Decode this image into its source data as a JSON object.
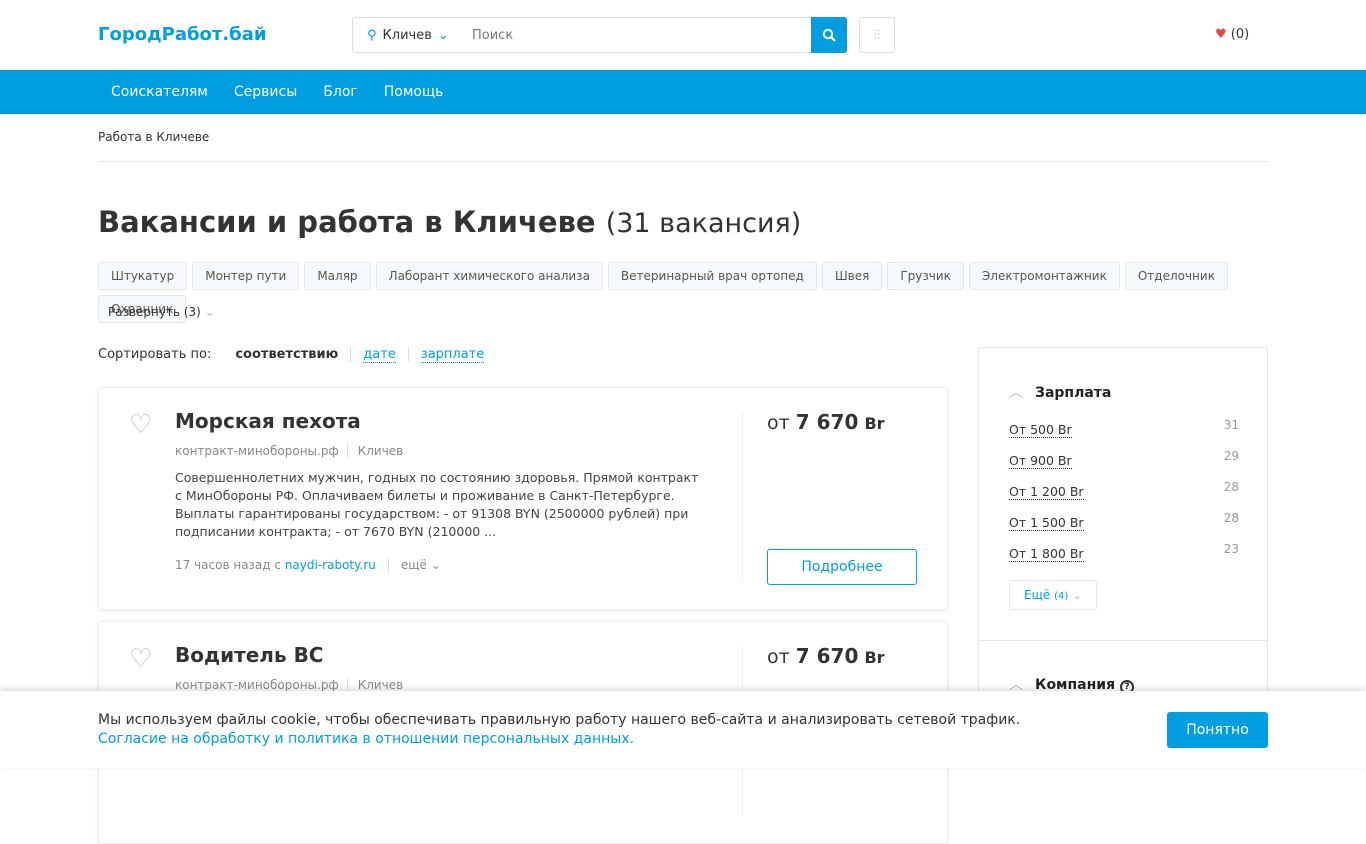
{
  "header": {
    "logo": "ГородРабот.бай",
    "location": "Кличев",
    "search_placeholder": "Поиск",
    "favorites": "(0)"
  },
  "nav": [
    "Соискателям",
    "Сервисы",
    "Блог",
    "Помощь"
  ],
  "breadcrumb": "Работа в Кличеве",
  "page_title": "Вакансии и работа в Кличеве",
  "page_count": "(31 вакансия)",
  "tags": [
    "Штукатур",
    "Монтер пути",
    "Маляр",
    "Лаборант химического анализа",
    "Ветеринарный врач ортопед",
    "Швея",
    "Грузчик",
    "Электромонтажник",
    "Отделочник",
    "Охранник"
  ],
  "expand": "Развернуть (3)",
  "sort": {
    "label": "Сортировать по:",
    "active": "соответствию",
    "options": [
      "дате",
      "зарплате"
    ]
  },
  "vacancies": [
    {
      "title": "Морская пехота",
      "company": "контракт-минобороны.рф",
      "city": "Кличев",
      "description": "Совершеннолетних мужчин, годных по состоянию здоровья. Прямой контракт с МинОбороны РФ. Оплачиваем билеты и проживание в Санкт-Петербурге. Выплаты гарантированы государством: - от 91308 BYN (2500000 рублей) при подписании контракта; - от 7670 BYN (210000 ...",
      "time": "17 часов назад с",
      "source": "naydi-raboty.ru",
      "more": "ещё",
      "price_prefix": "от",
      "price": "7 670",
      "currency": "Br",
      "details": "Подробнее"
    },
    {
      "title": "Водитель ВС",
      "company": "контракт-минобороны.рф",
      "city": "Кличев",
      "price_prefix": "от",
      "price": "7 670",
      "currency": "Br"
    }
  ],
  "sidebar": {
    "salary_title": "Зарплата",
    "salary": [
      {
        "label": "От 500 Br",
        "count": "31"
      },
      {
        "label": "От 900 Br",
        "count": "29"
      },
      {
        "label": "От 1 200 Br",
        "count": "28"
      },
      {
        "label": "От 1 500 Br",
        "count": "28"
      },
      {
        "label": "От 1 800 Br",
        "count": "23"
      }
    ],
    "more": "Ещё",
    "more_count": "(4)",
    "company_title": "Компания"
  },
  "cookie": {
    "text": "Мы используем файлы cookie, чтобы обеспечивать правильную работу нашего веб-сайта и анализировать сетевой трафик.",
    "link": "Согласие на обработку и политика в отношении персональных данных.",
    "ok": "Понятно"
  }
}
